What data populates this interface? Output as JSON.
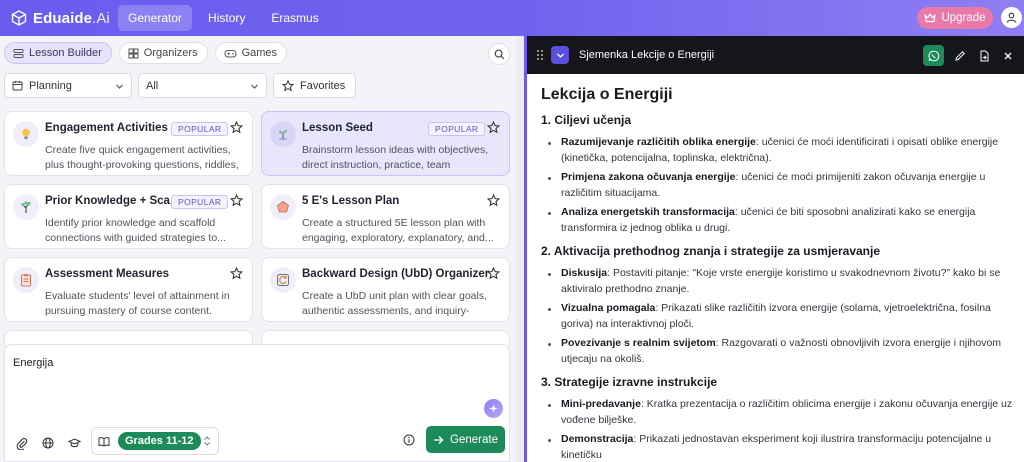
{
  "brand": {
    "name": "Eduaide",
    "suffix": ".Ai"
  },
  "nav": {
    "tabs": [
      "Generator",
      "History",
      "Erasmus"
    ],
    "upgrade": "Upgrade"
  },
  "subtabs": [
    "Lesson Builder",
    "Organizers",
    "Games"
  ],
  "filters": {
    "category": "Planning",
    "scope": "All",
    "favorites": "Favorites"
  },
  "cards": [
    {
      "title": "Engagement Activities",
      "badge": "POPULAR",
      "desc": "Create five quick engagement activities, plus thought-provoking questions, riddles, and..."
    },
    {
      "title": "Lesson Seed",
      "badge": "POPULAR",
      "desc": "Brainstorm lesson ideas with objectives, direct instruction, practice, team activities,..."
    },
    {
      "title": "Prior Knowledge + Sca...",
      "badge": "POPULAR",
      "desc": "Identify prior knowledge and scaffold connections with guided strategies to..."
    },
    {
      "title": "5 E's Lesson Plan",
      "badge": "",
      "desc": "Create a structured 5E lesson plan with engaging, exploratory, explanatory, and..."
    },
    {
      "title": "Assessment Measures",
      "badge": "",
      "desc": "Evaluate students' level of attainment in pursuing mastery of course content."
    },
    {
      "title": "Backward Design (UbD) Organizer",
      "badge": "",
      "desc": "Create a UbD unit plan with clear goals, authentic assessments, and inquiry-driven..."
    }
  ],
  "composer": {
    "text": "Energija",
    "grades": "Grades 11-12",
    "generate": "Generate"
  },
  "panel": {
    "title": "Sjemenka Lekcije o Energiji",
    "doc_title": "Lekcija o Energiji",
    "s1": {
      "heading": "1. Ciljevi učenja",
      "items": [
        {
          "b": "Razumijevanje različitih oblika energije",
          "t": ": učenici će moći identificirati i opisati oblike energije (kinetička, potencijalna, toplinska, električna)."
        },
        {
          "b": "Primjena zakona očuvanja energije",
          "t": ": učenici će moći primijeniti zakon očuvanja energije u različitim situacijama."
        },
        {
          "b": "Analiza energetskih transformacija",
          "t": ": učenici će biti sposobni analizirati kako se energija transformira iz jednog oblika u drugi."
        }
      ]
    },
    "s2": {
      "heading": "2. Aktivacija prethodnog znanja i strategije za usmjeravanje",
      "items": [
        {
          "b": "Diskusija",
          "t": ": Postaviti pitanje: \"Koje vrste energije koristimo u svakodnevnom životu?\" kako bi se aktiviralo prethodno znanje."
        },
        {
          "b": "Vizualna pomagala",
          "t": ": Prikazati slike različitih izvora energije (solarna, vjetroelektrična, fosilna goriva) na interaktivnoj ploči."
        },
        {
          "b": "Povezivanje s realnim svijetom",
          "t": ": Razgovarati o važnosti obnovljivih izvora energije i njihovom utjecaju na okoliš."
        }
      ]
    },
    "s3": {
      "heading": "3. Strategije izravne instrukcije",
      "items": [
        {
          "b": "Mini-predavanje",
          "t": ": Kratka prezentacija o različitim oblicima energije i zakonu očuvanja energije uz vođene bilješke."
        },
        {
          "b": "Demonstracija",
          "t": ": Prikazati jednostavan eksperiment koji ilustrira transformaciju potencijalne u kinetičku"
        }
      ]
    }
  },
  "colors": {
    "brand": "#6a5cf0",
    "green": "#1d8a5a",
    "upgrade": "#e879a8",
    "header_dark": "#15161b"
  }
}
